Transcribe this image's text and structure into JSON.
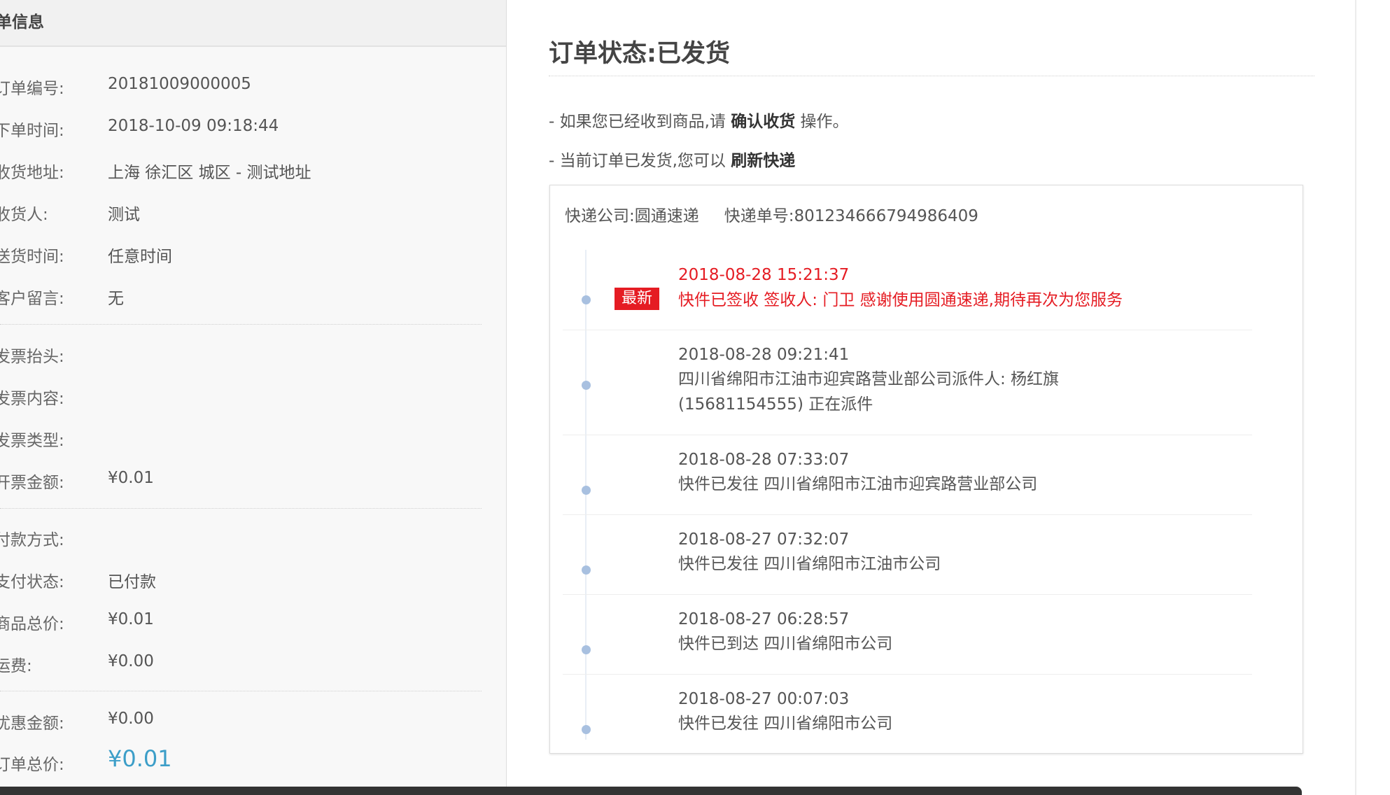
{
  "left": {
    "title": "单信息",
    "rows": [
      {
        "label": "订单编号:",
        "value": "20181009000005"
      },
      {
        "label": "下单时间:",
        "value": "2018-10-09 09:18:44"
      },
      {
        "label": "收货地址:",
        "value": "上海 徐汇区 城区 - 测试地址"
      },
      {
        "label": "收货人:",
        "value": "测试"
      },
      {
        "label": "送货时间:",
        "value": "任意时间"
      },
      {
        "label": "客户留言:",
        "value": "无"
      },
      {
        "label": "发票抬头:",
        "value": ""
      },
      {
        "label": "发票内容:",
        "value": ""
      },
      {
        "label": "发票类型:",
        "value": ""
      },
      {
        "label": "开票金额:",
        "value": "¥0.01"
      },
      {
        "label": "付款方式:",
        "value": ""
      },
      {
        "label": "支付状态:",
        "value": "已付款"
      },
      {
        "label": "商品总价:",
        "value": "¥0.01"
      },
      {
        "label": "运费:",
        "value": "¥0.00"
      },
      {
        "label": "优惠金额:",
        "value": "¥0.00"
      },
      {
        "label": "订单总价:",
        "value": "¥0.01"
      }
    ]
  },
  "status": {
    "title": "订单状态:已发货",
    "tip1_prefix": "- 如果您已经收到商品,请",
    "tip1_action": "确认收货",
    "tip1_suffix": "操作。",
    "tip2_prefix": "- 当前订单已发货,您可以",
    "tip2_action": "刷新快递"
  },
  "shipping": {
    "company_label": "快递公司:",
    "company": "圆通速递",
    "tracking_label": "快递单号:",
    "tracking_no": "801234666794986409",
    "latest_badge": "最新",
    "events": [
      {
        "time": "2018-08-28 15:21:37",
        "desc": "快件已签收 签收人: 门卫 感谢使用圆通速递,期待再次为您服务"
      },
      {
        "time": "2018-08-28 09:21:41",
        "desc": "四川省绵阳市江油市迎宾路营业部公司派件人: 杨红旗 (15681154555) 正在派件"
      },
      {
        "time": "2018-08-28 07:33:07",
        "desc": "快件已发往 四川省绵阳市江油市迎宾路营业部公司"
      },
      {
        "time": "2018-08-27 07:32:07",
        "desc": "快件已发往 四川省绵阳市江油市公司"
      },
      {
        "time": "2018-08-27 06:28:57",
        "desc": "快件已到达 四川省绵阳市公司"
      },
      {
        "time": "2018-08-27 00:07:03",
        "desc": "快件已发往 四川省绵阳市公司"
      }
    ]
  },
  "colors": {
    "latest": "#e51c23",
    "total_price": "#3c9ec8",
    "dot": "#a8c0e0"
  }
}
